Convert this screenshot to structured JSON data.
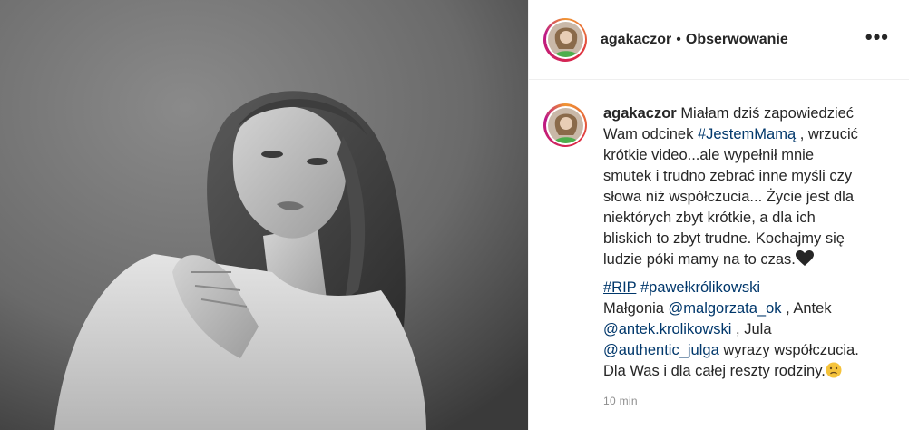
{
  "header": {
    "username": "agakaczor",
    "separator": "•",
    "follow_label": "Obserwowanie",
    "more_label": "•••"
  },
  "caption": {
    "username": "agakaczor",
    "line1_rest": "Miałam dziś zapowiedzieć",
    "line2_pre": "Wam odcinek ",
    "hashtag1": "#JestemMamą",
    "line2_post": " , wrzucić",
    "line3": "krótkie video...ale wypełnił mnie",
    "line4": "smutek i trudno zebrać inne myśli czy",
    "line5": "słowa niż współczucia... Życie jest dla",
    "line6": "niektórych zbyt krótkie, a dla ich",
    "line7": "bliskich to zbyt trudne. Kochajmy się",
    "line8": "ludzie póki mamy na to czas.",
    "divider": "..............................................",
    "hashtag2": "#RIP",
    "hashtag3": "#pawełkrólikowski",
    "line_m1": "Małgonia ",
    "mention1": "@malgorzata_ok",
    "line_m1_post": " , Antek",
    "mention2": "@antek.krolikowski",
    "line_m2_post": " , Jula",
    "mention3": "@authentic_julga",
    "line_m3_post": " wyrazy współczucia.",
    "line_last": "Dla Was i dla całej reszty rodziny.",
    "time": "10 min"
  },
  "colors": {
    "text": "#262626",
    "link": "#00376b",
    "muted": "#8e8e8e",
    "border": "#efefef"
  }
}
